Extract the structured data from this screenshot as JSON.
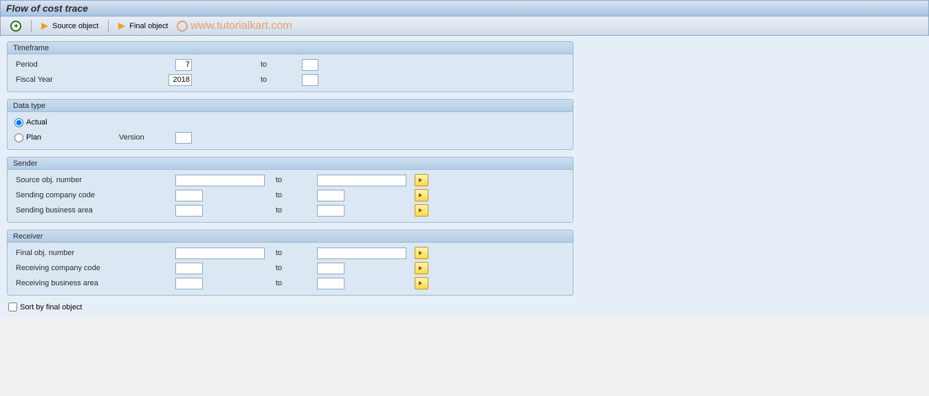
{
  "title": "Flow of cost trace",
  "toolbar": {
    "source_object": "Source object",
    "final_object": "Final object"
  },
  "watermark": "www.tutorialkart.com",
  "timeframe": {
    "header": "Timeframe",
    "period_label": "Period",
    "period_value": "7",
    "period_to": "",
    "fiscal_label": "Fiscal Year",
    "fiscal_value": "2018",
    "fiscal_to": "",
    "to_label": "to"
  },
  "datatype": {
    "header": "Data type",
    "actual_label": "Actual",
    "plan_label": "Plan",
    "version_label": "Version",
    "version_value": ""
  },
  "sender": {
    "header": "Sender",
    "source_obj_label": "Source obj. number",
    "company_label": "Sending company code",
    "area_label": "Sending business area",
    "to_label": "to"
  },
  "receiver": {
    "header": "Receiver",
    "final_obj_label": "Final obj. number",
    "company_label": "Receiving company code",
    "area_label": "Receiving business area",
    "to_label": "to"
  },
  "sort_by_final": "Sort by final object"
}
